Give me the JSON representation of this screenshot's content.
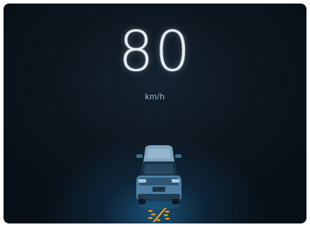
{
  "cluster": {
    "speed_value": "80",
    "speed_unit": "km/h"
  },
  "icons": {
    "vehicle": "car-rear-icon",
    "lane_departure_warning": "lane-departure-warning-icon"
  },
  "colors": {
    "background": "#0d161f",
    "glow": "#2a8ec6",
    "speed_text": "#e7eef5",
    "unit_text": "#9fb6c9",
    "warning": "#f39a1a"
  }
}
